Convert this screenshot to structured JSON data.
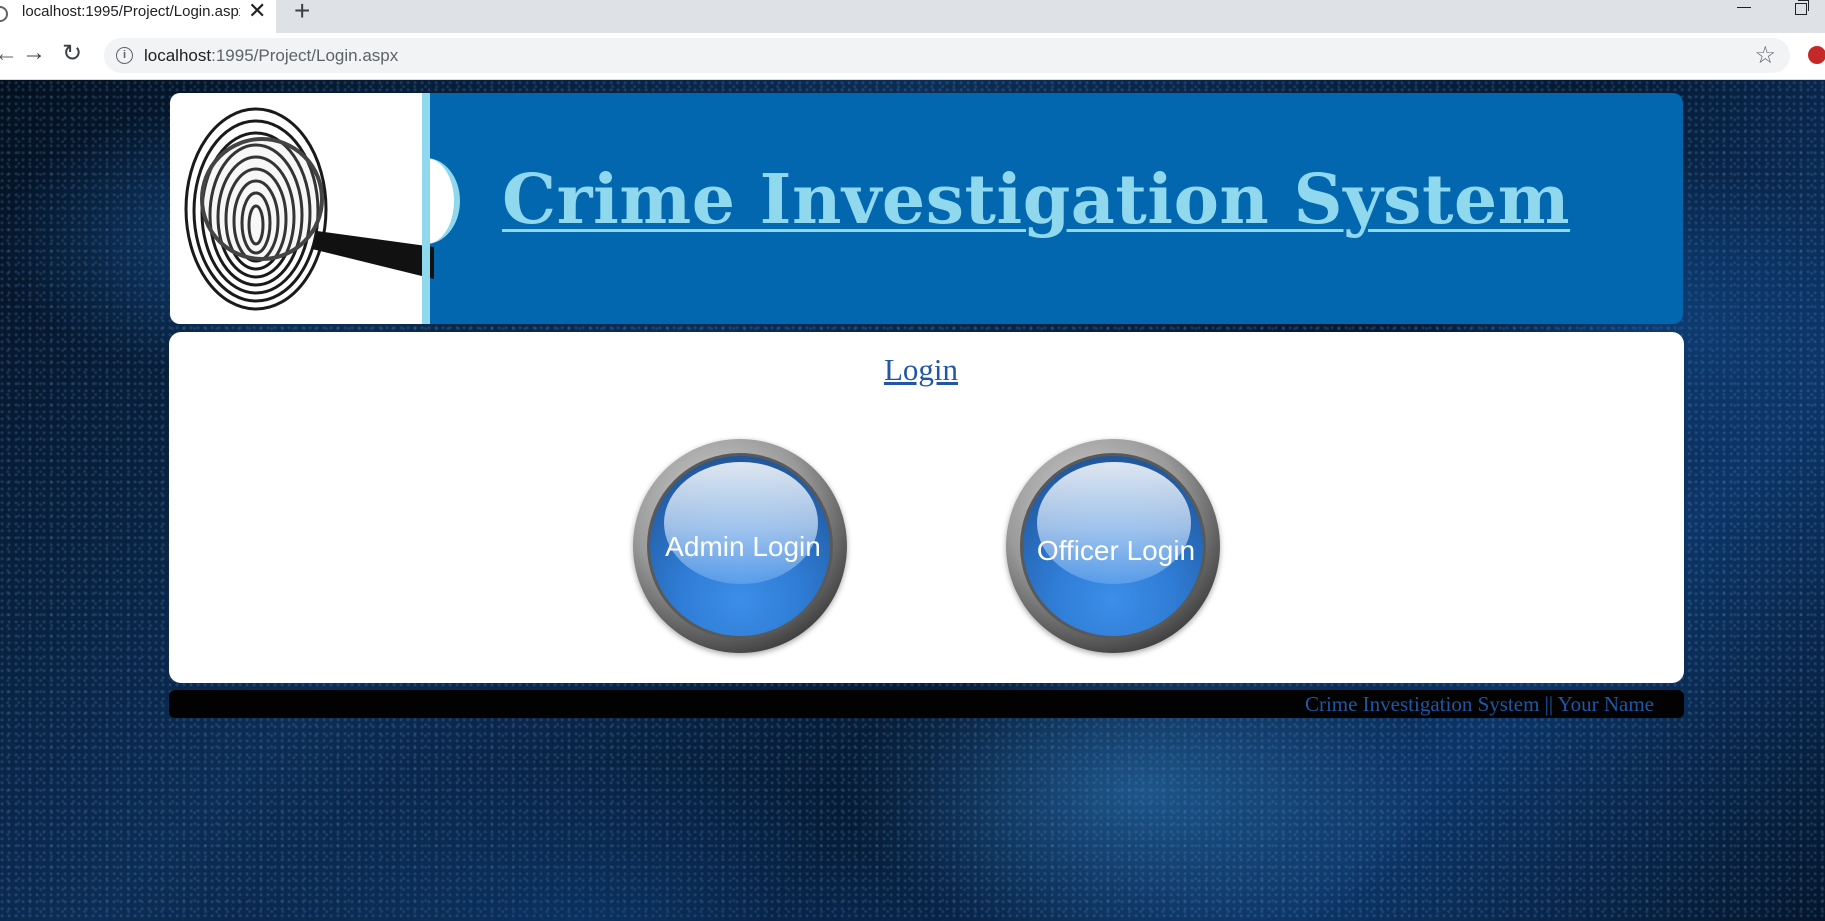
{
  "browser": {
    "tab_title": "localhost:1995/Project/Login.aspx",
    "tab_close": "✕",
    "new_tab": "+",
    "url_host": "localhost",
    "url_path": ":1995/Project/Login.aspx",
    "icons": [
      "back-icon",
      "forward-icon",
      "reload-icon",
      "info-icon",
      "star-icon",
      "minimize-icon",
      "restore-icon"
    ]
  },
  "header": {
    "title": "Crime Investigation System"
  },
  "login": {
    "heading": "Login",
    "admin_button": "Admin Login",
    "officer_button": "Officer Login"
  },
  "footer": {
    "text": "Crime Investigation System  ||  Your Name"
  },
  "colors": {
    "banner_blue": "#0367b0",
    "title_cyan": "#8fd8ee",
    "link_blue": "#1f57a6",
    "orb_blue": "#2f7dd6",
    "footer_bg": "#020202"
  }
}
